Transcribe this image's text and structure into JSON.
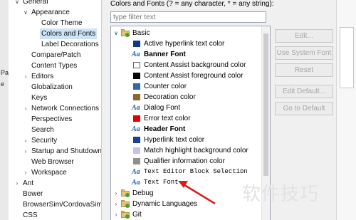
{
  "left_edge_chars": [
    "Pa",
    "e"
  ],
  "nav": {
    "items": [
      {
        "label": "General",
        "toggle": "v"
      },
      {
        "label": "Appearance",
        "toggle": "v"
      },
      {
        "label": "Color Theme",
        "toggle": ""
      },
      {
        "label": "Colors and Fonts",
        "toggle": "",
        "selected": true
      },
      {
        "label": "Label Decorations",
        "toggle": ""
      },
      {
        "label": "Compare/Patch",
        "toggle": ""
      },
      {
        "label": "Content Types",
        "toggle": ""
      },
      {
        "label": "Editors",
        "toggle": ">"
      },
      {
        "label": "Globalization",
        "toggle": ""
      },
      {
        "label": "Keys",
        "toggle": ""
      },
      {
        "label": "Network Connections",
        "toggle": ">"
      },
      {
        "label": "Perspectives",
        "toggle": ""
      },
      {
        "label": "Search",
        "toggle": ""
      },
      {
        "label": "Security",
        "toggle": ">"
      },
      {
        "label": "Startup and Shutdown",
        "toggle": ">"
      },
      {
        "label": "Web Browser",
        "toggle": ""
      },
      {
        "label": "Workspace",
        "toggle": ">"
      },
      {
        "label": "Ant",
        "toggle": ">"
      },
      {
        "label": "Bower",
        "toggle": ""
      },
      {
        "label": "BrowserSim/CordovaSim",
        "toggle": ""
      },
      {
        "label": "CSS",
        "toggle": ""
      }
    ]
  },
  "panel": {
    "title": "Colors and Fonts (? = any character, * = any string):",
    "filter_placeholder": "type filter text"
  },
  "tree": {
    "items": [
      {
        "label": "Basic",
        "kind": "folder",
        "toggle": "v"
      },
      {
        "label": "Active hyperlink text color",
        "kind": "color",
        "color": "#0d3b8a"
      },
      {
        "label": "Banner Font",
        "kind": "font",
        "style": "bold"
      },
      {
        "label": "Content Assist background color",
        "kind": "color",
        "color": "#ffffff"
      },
      {
        "label": "Content Assist foreground color",
        "kind": "color",
        "color": "#000000"
      },
      {
        "label": "Counter color",
        "kind": "color",
        "color": "#2e6aa6"
      },
      {
        "label": "Decoration color",
        "kind": "color",
        "color": "#8a6a2c"
      },
      {
        "label": "Dialog Font",
        "kind": "font",
        "style": "normal"
      },
      {
        "label": "Error text color",
        "kind": "color",
        "color": "#e00000"
      },
      {
        "label": "Header Font",
        "kind": "font",
        "style": "bold"
      },
      {
        "label": "Hyperlink text color",
        "kind": "color",
        "color": "#1a3fa0"
      },
      {
        "label": "Match highlight background color",
        "kind": "color",
        "color": "#c9c2e8"
      },
      {
        "label": "Qualifier information color",
        "kind": "color",
        "color": "#8f8f8f"
      },
      {
        "label": "Text Editor Block Selection",
        "kind": "font",
        "style": "mono"
      },
      {
        "label": "Text Font",
        "kind": "font",
        "style": "mono"
      },
      {
        "label": "Debug",
        "kind": "folder",
        "toggle": ">"
      },
      {
        "label": "Dynamic Languages",
        "kind": "folder",
        "toggle": ">"
      },
      {
        "label": "Git",
        "kind": "folder",
        "toggle": ">"
      }
    ]
  },
  "buttons": [
    {
      "label": "Edit..."
    },
    {
      "label": "Use System Font"
    },
    {
      "label": "Reset"
    },
    {
      "label": "Edit Default..."
    },
    {
      "label": "Go to Default"
    }
  ],
  "watermark": "软件技巧",
  "colors": {
    "selection": "#cce4f7",
    "annotation_arrow": "#e21b1b"
  }
}
